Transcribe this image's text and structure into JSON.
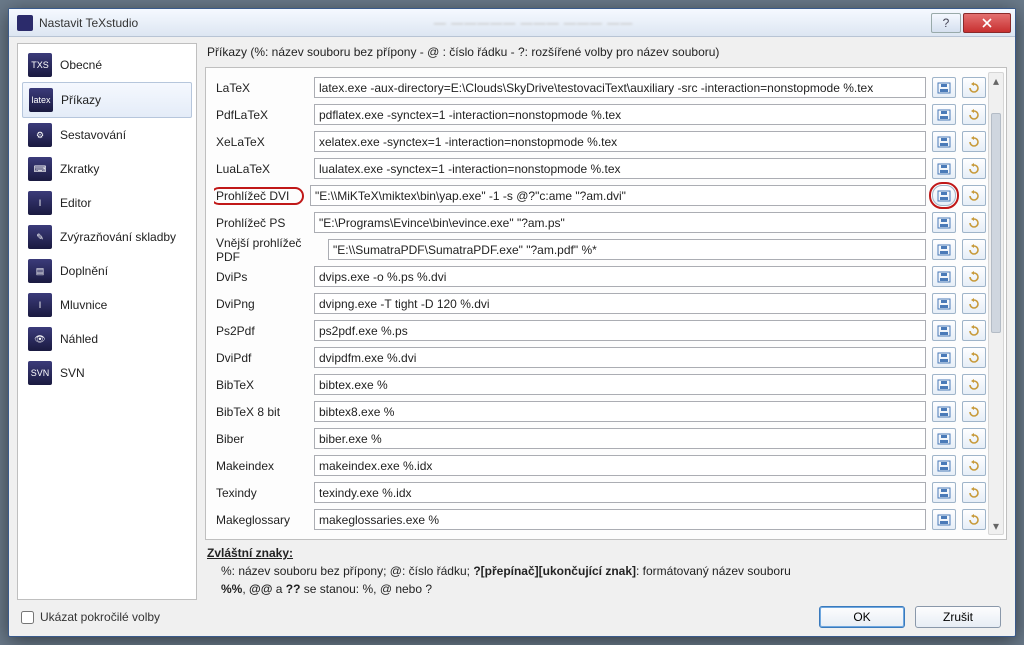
{
  "window": {
    "title": "Nastavit TeXstudio"
  },
  "sidebar": {
    "items": [
      {
        "label": "Obecné",
        "code": "TXS"
      },
      {
        "label": "Příkazy",
        "code": "latex"
      },
      {
        "label": "Sestavování",
        "code": "⚙"
      },
      {
        "label": "Zkratky",
        "code": "⌨"
      },
      {
        "label": "Editor",
        "code": "I"
      },
      {
        "label": "Zvýrazňování skladby",
        "code": "✎"
      },
      {
        "label": "Doplnění",
        "code": "▤"
      },
      {
        "label": "Mluvnice",
        "code": "I"
      },
      {
        "label": "Náhled",
        "code": "👁"
      },
      {
        "label": "SVN",
        "code": "SVN"
      }
    ],
    "selected_index": 1
  },
  "header": "Příkazy (%: název souboru bez přípony - @ : číslo řádku - ?: rozšířené volby pro název souboru)",
  "commands": [
    {
      "label": "LaTeX",
      "value": "latex.exe -aux-directory=E:\\Clouds\\SkyDrive\\testovaciText\\auxiliary -src -interaction=nonstopmode %.tex"
    },
    {
      "label": "PdfLaTeX",
      "value": "pdflatex.exe -synctex=1 -interaction=nonstopmode %.tex"
    },
    {
      "label": "XeLaTeX",
      "value": "xelatex.exe -synctex=1 -interaction=nonstopmode %.tex"
    },
    {
      "label": "LuaLaTeX",
      "value": "lualatex.exe -synctex=1 -interaction=nonstopmode %.tex"
    },
    {
      "label": "Prohlížeč DVI",
      "value": "\"E:\\\\MiKTeX\\miktex\\bin\\yap.exe\" -1 -s @?\"c:ame \"?am.dvi\"",
      "circledLabel": true,
      "circledOpen": true
    },
    {
      "label": "Prohlížeč PS",
      "value": "\"E:\\Programs\\Evince\\bin\\evince.exe\" \"?am.ps\""
    },
    {
      "label": "Vnější prohlížeč PDF",
      "value": "\"E:\\\\SumatraPDF\\SumatraPDF.exe\" \"?am.pdf\" %*",
      "wideLabel": true
    },
    {
      "label": "DviPs",
      "value": "dvips.exe -o %.ps %.dvi"
    },
    {
      "label": "DviPng",
      "value": "dvipng.exe -T tight -D 120 %.dvi"
    },
    {
      "label": "Ps2Pdf",
      "value": "ps2pdf.exe %.ps"
    },
    {
      "label": "DviPdf",
      "value": "dvipdfm.exe %.dvi"
    },
    {
      "label": "BibTeX",
      "value": "bibtex.exe %"
    },
    {
      "label": "BibTeX 8 bit",
      "value": "bibtex8.exe %"
    },
    {
      "label": "Biber",
      "value": "biber.exe %"
    },
    {
      "label": "Makeindex",
      "value": "makeindex.exe %.idx"
    },
    {
      "label": "Texindy",
      "value": "texindy.exe %.idx"
    },
    {
      "label": "Makeglossary",
      "value": "makeglossaries.exe %"
    }
  ],
  "special": {
    "heading": "Zvláštní znaky:",
    "line1_before": "%: název souboru bez přípony; @: číslo řádku; ",
    "line1_bold": "?[přepínač][ukončující znak]",
    "line1_after": ": formátovaný název souboru",
    "line2_a": "%%",
    "line2_b": ", ",
    "line2_c": "@@",
    "line2_d": " a ",
    "line2_e": "??",
    "line2_f": " se stanou: %, @ nebo ?"
  },
  "advanced_label": "Ukázat pokročilé volby",
  "buttons": {
    "ok": "OK",
    "cancel": "Zrušit"
  }
}
